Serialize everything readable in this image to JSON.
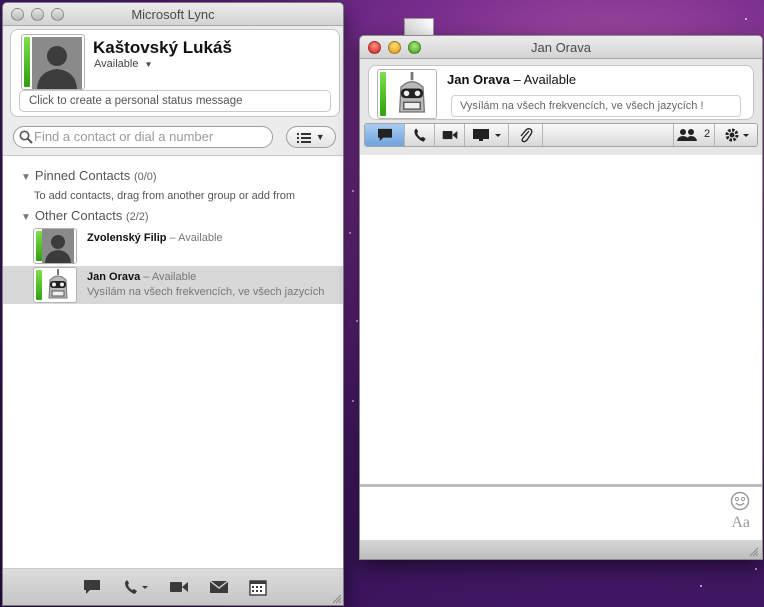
{
  "lync_window": {
    "title": "Microsoft Lync",
    "me": {
      "name": "Kaštovský Lukáš",
      "status": "Available",
      "status_message_placeholder": "Click to create a personal status message",
      "presence_color": "#3cb515"
    },
    "search": {
      "placeholder": "Find a contact or dial a number"
    },
    "groups": [
      {
        "name": "Pinned Contacts",
        "count": "(0/0)",
        "hint": "To add contacts, drag from another group or add from"
      },
      {
        "name": "Other Contacts",
        "count": "(2/2)"
      }
    ],
    "contacts": [
      {
        "name": "Zvolenský Filip",
        "status": " – Available",
        "note": ""
      },
      {
        "name": "Jan Orava",
        "status": " – Available",
        "note": "Vysílám na všech frekvencích, ve všech jazycích"
      }
    ],
    "bottom_bar": [
      "im-icon",
      "phone-icon",
      "video-icon",
      "mail-icon",
      "calendar-icon"
    ]
  },
  "conversation_window": {
    "title": "Jan Orava",
    "contact": {
      "name": "Jan Orava",
      "status": " – Available",
      "note": "Vysílám na všech frekvencích, ve všech jazycích !"
    },
    "participants": "2",
    "toolbar": [
      "im-icon",
      "phone-icon",
      "video-icon",
      "screen-share-icon",
      "attach-icon",
      "participants-icon",
      "gear-icon"
    ],
    "font_label": "Aa"
  }
}
